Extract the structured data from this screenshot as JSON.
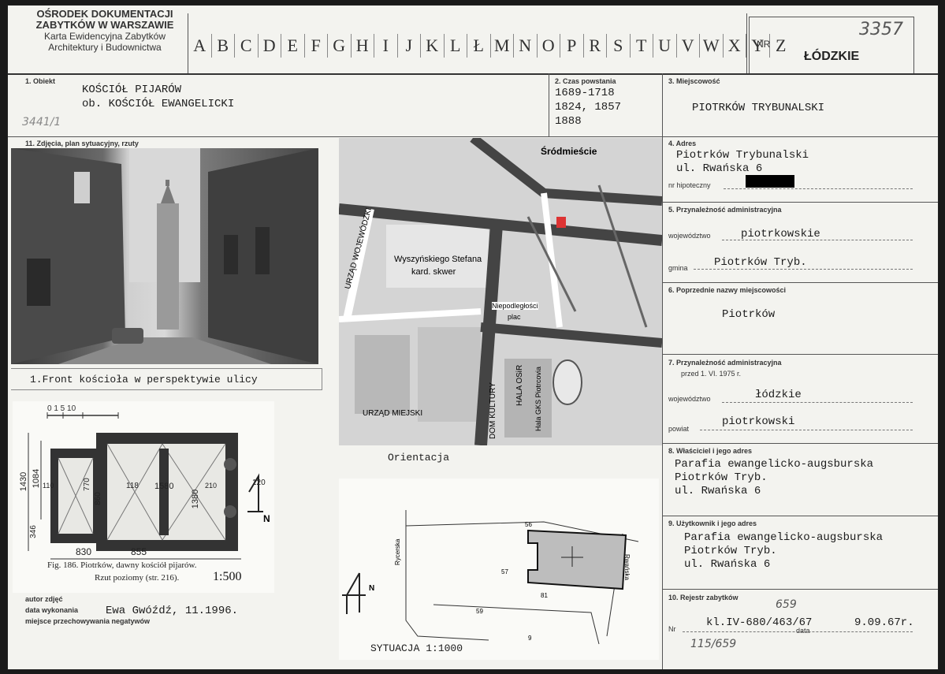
{
  "header": {
    "institution": [
      "OŚRODEK DOKUMENTACJI",
      "ZABYTKÓW W WARSZAWIE",
      "Karta Ewidencyjna Zabytków",
      "Architektury i Budownictwa"
    ],
    "letters": [
      "A",
      "B",
      "C",
      "D",
      "E",
      "F",
      "G",
      "H",
      "I",
      "J",
      "K",
      "L",
      "Ł",
      "M",
      "N",
      "O",
      "P",
      "R",
      "S",
      "T",
      "U",
      "V",
      "W",
      "X",
      "Y",
      "Z"
    ],
    "nr_label": "NR",
    "voivodeship": "ŁÓDZKIE",
    "handwritten_nr": "3357"
  },
  "obiekt": {
    "label": "1. Obiekt",
    "line1": "KOŚCIÓŁ PIJARÓW",
    "line2": "ob. KOŚCIÓŁ EWANGELICKI",
    "margin_note": "3441/1"
  },
  "czas": {
    "label": "2. Czas powstania",
    "line1": "1689-1718",
    "line2": "1824, 1857",
    "line3": "1888"
  },
  "miejscowosc": {
    "label": "3. Miejscowość",
    "value": "PIOTRKÓW TRYBUNALSKI"
  },
  "photos": {
    "label": "11. Zdjęcia, plan sytuacyjny, rzuty",
    "caption1": "1.Front kościoła w perspektywie ulicy",
    "map_label": "Śródmieście",
    "map_texts": [
      "Wyszyńskiego Stefana",
      "kard. skwer",
      "Niepodległości",
      "plac",
      "URZĄD WOJEWÓDZKI",
      "URZĄD MIEJSKI",
      "HALA OSiR",
      "DOM KULTURY",
      "Hala GKS Piotrcovia"
    ],
    "orientation": "Orientacja",
    "plan_scale": "0  1  5    10",
    "plan_dims": [
      "1430",
      "1084",
      "346",
      "110",
      "770",
      "860",
      "118",
      "1580",
      "1380",
      "210",
      "120",
      "830",
      "855"
    ],
    "plan_caption": "Fig. 186. Piotrków, dawny kościół pijarów.",
    "plan_caption2": "Rzut poziomy (str. 216).",
    "plan_ratio": "1:500",
    "north": "N",
    "site_numbers": [
      "56",
      "57",
      "81",
      "59",
      "9"
    ],
    "site_streets": [
      "Rycerska",
      "Rwańska"
    ],
    "site_caption": "SYTUACJA 1:1000"
  },
  "author": {
    "autor_label": "autor zdjęć",
    "data_label": "data wykonania",
    "miejsce_label": "miejsce przechowywania negatywów",
    "value": "Ewa Gwóźdź, 11.1996."
  },
  "adres": {
    "label": "4. Adres",
    "line1": "Piotrków Trybunalski",
    "line2": "ul. Rwańska 6",
    "hipoteczny_label": "nr hipoteczny"
  },
  "przynaleznosc": {
    "label": "5. Przynależność administracyjna",
    "woj_label": "województwo",
    "woj": "piotrkowskie",
    "gmina_label": "gmina",
    "gmina": "Piotrków Tryb."
  },
  "poprzednie": {
    "label": "6. Poprzednie nazwy miejscowości",
    "value": "Piotrków"
  },
  "przynaleznosc2": {
    "label": "7. Przynależność administracyjna",
    "sublabel": "przed 1. VI. 1975 r.",
    "woj_label": "województwo",
    "woj": "łódzkie",
    "powiat_label": "powiat",
    "powiat": "piotrkowski"
  },
  "wlasciciel": {
    "label": "8. Właściciel i jego adres",
    "line1": "Parafia ewangelicko-augsburska",
    "line2": "Piotrków Tryb.",
    "line3": "ul. Rwańska 6"
  },
  "uzytkownik": {
    "label": "9. Użytkownik i jego adres",
    "line1": "Parafia ewangelicko-augsburska",
    "line2": "Piotrków Tryb.",
    "line3": "ul. Rwańska 6"
  },
  "rejestr": {
    "label": "10. Rejestr zabytków",
    "nr_label": "Nr",
    "data_label": "data",
    "nr": "kl.IV-680/463/67",
    "data": "9.09.67r.",
    "hand1": "659",
    "hand2": "115/659"
  }
}
